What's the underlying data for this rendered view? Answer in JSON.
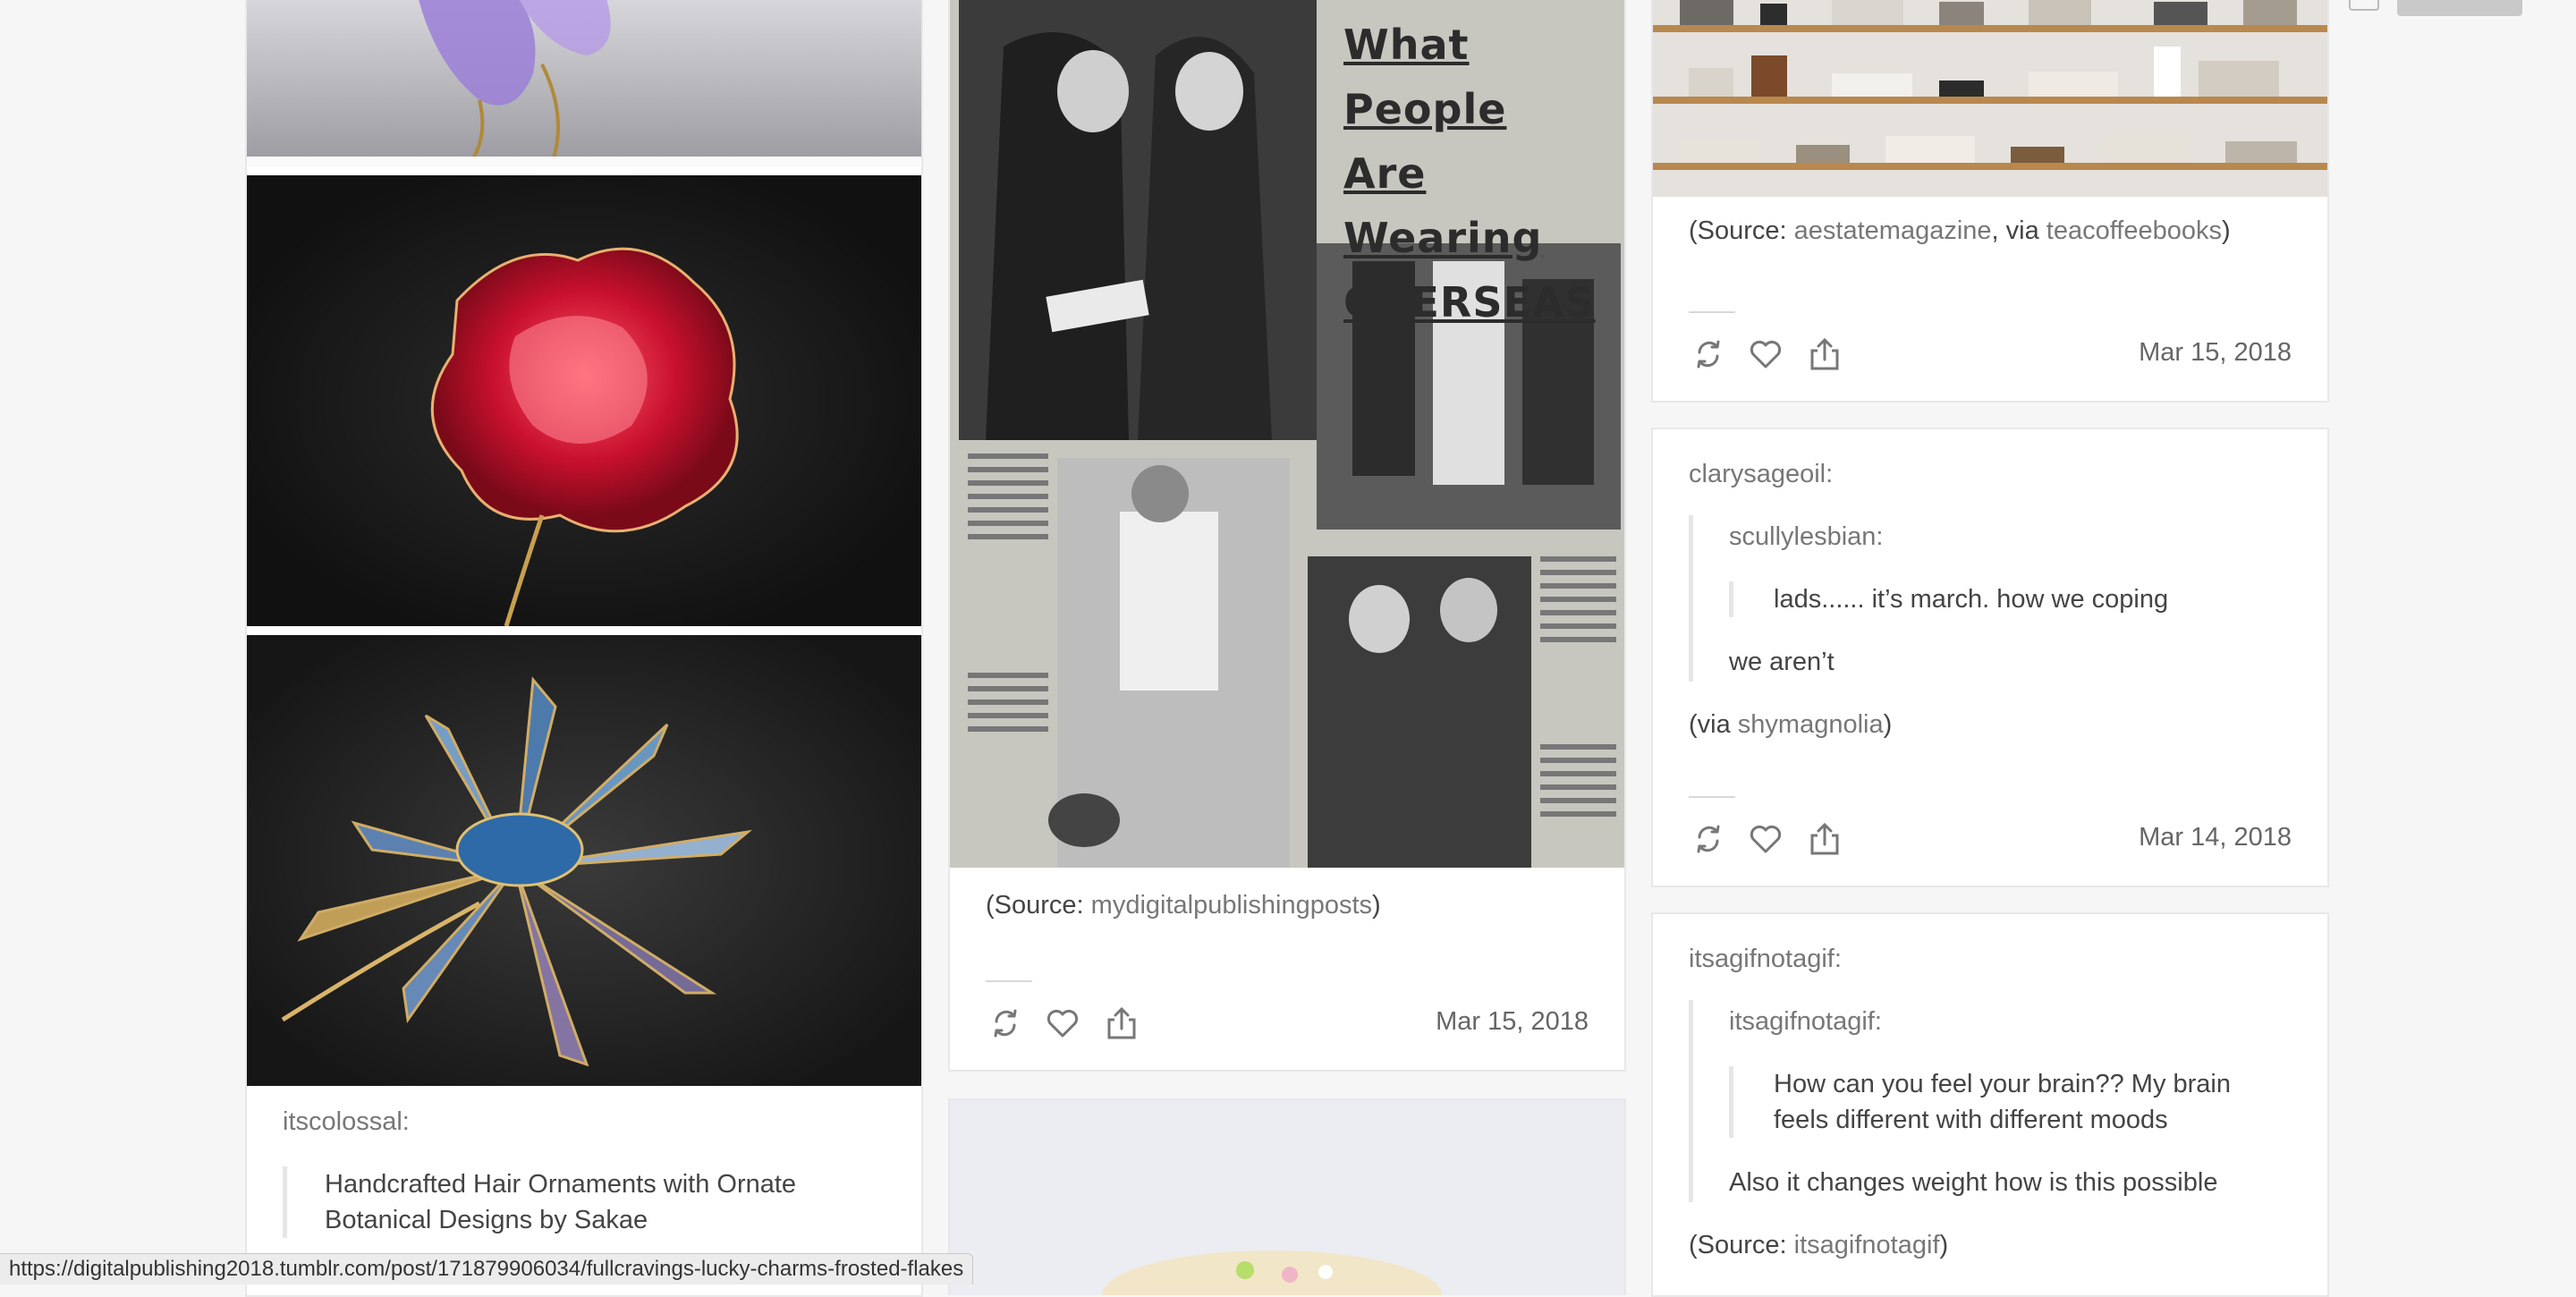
{
  "colors": {
    "accent_link": "#777777",
    "page_bg": "#f6f6f6"
  },
  "col1": {
    "post_caption": {
      "author": "itscolossal:",
      "quote": "Handcrafted Hair Ornaments with Ornate Botanical Designs by Sakae"
    }
  },
  "col2": {
    "newspaper_headline": [
      "What People",
      "Are Wearing",
      "OVERSEAS"
    ],
    "source_prefix": "(Source: ",
    "source_link": "mydigitalpublishingposts",
    "source_suffix": ")",
    "date": "Mar 15, 2018"
  },
  "col3": {
    "post1": {
      "source_prefix": "(Source: ",
      "source_link": "aestatemagazine",
      "via_text": ", via ",
      "via_link": "teacoffeebooks",
      "suffix": ")",
      "date": "Mar 15, 2018"
    },
    "post2": {
      "author": "clarysageoil:",
      "nested_author": "scullylesbian:",
      "nested_quote": "lads...... it’s march. how we coping",
      "reply": "we aren’t",
      "via_prefix": "(via ",
      "via_link": "shymagnolia",
      "via_suffix": ")",
      "date": "Mar 14, 2018"
    },
    "post3": {
      "author": "itsagifnotagif:",
      "nested_author": "itsagifnotagif:",
      "nested_quote": "How can you feel your brain?? My brain feels different with different moods",
      "reply": "Also it changes weight how is this possible",
      "source_prefix": "(Source: ",
      "source_link": "itsagifnotagif",
      "source_suffix": ")"
    }
  },
  "icons": {
    "reblog": "reblog-icon",
    "like": "heart-icon",
    "share": "share-icon"
  },
  "status_bar": {
    "url": "https://digitalpublishing2018.tumblr.com/post/171879906034/fullcravings-lucky-charms-frosted-flakes"
  }
}
